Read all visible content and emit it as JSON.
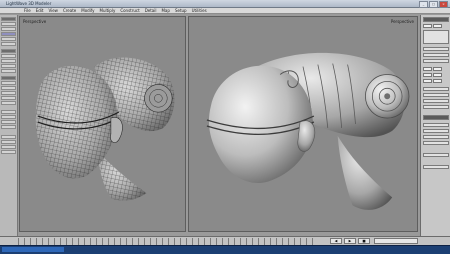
{
  "window": {
    "title": "LightWave 3D Modeler",
    "buttons": [
      "_",
      "□",
      "×"
    ]
  },
  "menubar": {
    "items": [
      "File",
      "Edit",
      "View",
      "Create",
      "Modify",
      "Multiply",
      "Construct",
      "Detail",
      "Map",
      "Setup",
      "Utilities"
    ]
  },
  "left_toolbar": {
    "items": [
      "",
      "",
      "",
      "",
      "",
      "",
      "",
      "",
      "",
      "",
      "",
      "",
      "",
      "",
      "",
      "",
      "",
      "",
      "",
      "",
      "",
      "",
      "",
      "",
      ""
    ]
  },
  "viewports": {
    "left": {
      "label": "Perspective",
      "shading": "Wireframe Shade"
    },
    "right": {
      "label": "Perspective",
      "shading": "Smooth Shade"
    }
  },
  "right_panel": {
    "items": [
      "",
      "",
      "",
      "",
      "",
      "",
      "",
      "",
      "",
      "",
      "",
      "",
      "",
      "",
      "",
      "",
      "",
      "",
      "",
      "",
      "",
      "",
      "",
      ""
    ]
  },
  "timeline": {
    "controls": [
      "◀",
      "▶",
      "■"
    ]
  },
  "statusbar": {
    "message": "",
    "tray": ""
  },
  "colors": {
    "accent": "#1c3f73",
    "viewport_bg": "#8a8a8a",
    "panel_bg": "#c7c7c7"
  }
}
